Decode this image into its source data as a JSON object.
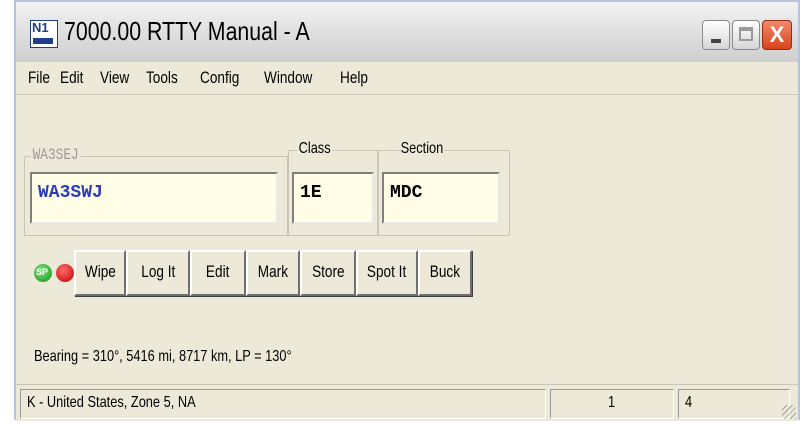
{
  "window": {
    "title": "7000.00 RTTY Manual - A",
    "icon_text": "N1",
    "close_glyph": "X"
  },
  "menu": {
    "items": [
      "File",
      "Edit",
      "View",
      "Tools",
      "Config",
      "Window",
      "Help"
    ]
  },
  "entry": {
    "call_label": "WA3SEJ",
    "call_value": "WA3SWJ",
    "class_label": "Class",
    "class_value": "1E",
    "section_label": "Section",
    "section_value": "MDC"
  },
  "indicators": {
    "green_led_text": "SP",
    "green_color": "#109010",
    "red_color": "#c00000"
  },
  "buttons": [
    "Wipe",
    "Log It",
    "Edit",
    "Mark",
    "Store",
    "Spot It",
    "Buck"
  ],
  "info_line": "Bearing = 310°, 5416 mi, 8717 km, LP = 130°",
  "status": {
    "country": "K - United States, Zone 5, NA",
    "pane2": "1",
    "pane3": "4"
  },
  "colors": {
    "call_text": "#2a3cb8",
    "field_bg": "#fffde6"
  }
}
